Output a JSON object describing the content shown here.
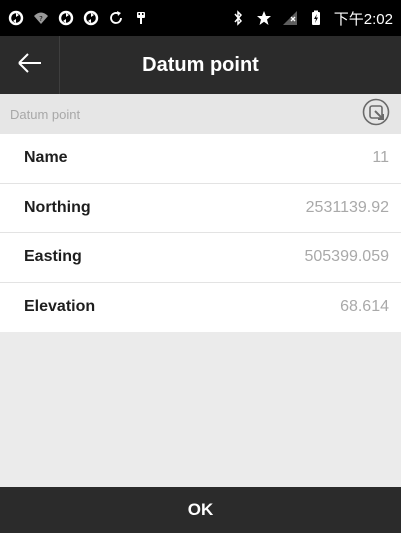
{
  "status_bar": {
    "time": "下午2:02",
    "icons": [
      "sync-icon",
      "wifi-question-icon",
      "sync-icon",
      "sync-icon",
      "refresh-icon",
      "usb-icon",
      "bluetooth-icon",
      "star-icon",
      "no-signal-icon",
      "battery-charging-icon"
    ]
  },
  "app_bar": {
    "title": "Datum point",
    "back_icon": "arrow-left-icon"
  },
  "section": {
    "label": "Datum point",
    "action_icon": "select-point-icon"
  },
  "fields": [
    {
      "label": "Name",
      "value": "11"
    },
    {
      "label": "Northing",
      "value": "2531139.92"
    },
    {
      "label": "Easting",
      "value": "505399.059"
    },
    {
      "label": "Elevation",
      "value": "68.614"
    }
  ],
  "ok_button": {
    "label": "OK"
  },
  "colors": {
    "app_bar": "#2b2b2b",
    "background": "#ebebeb",
    "row_bg": "#ffffff",
    "muted_text": "#a9a9a9"
  }
}
